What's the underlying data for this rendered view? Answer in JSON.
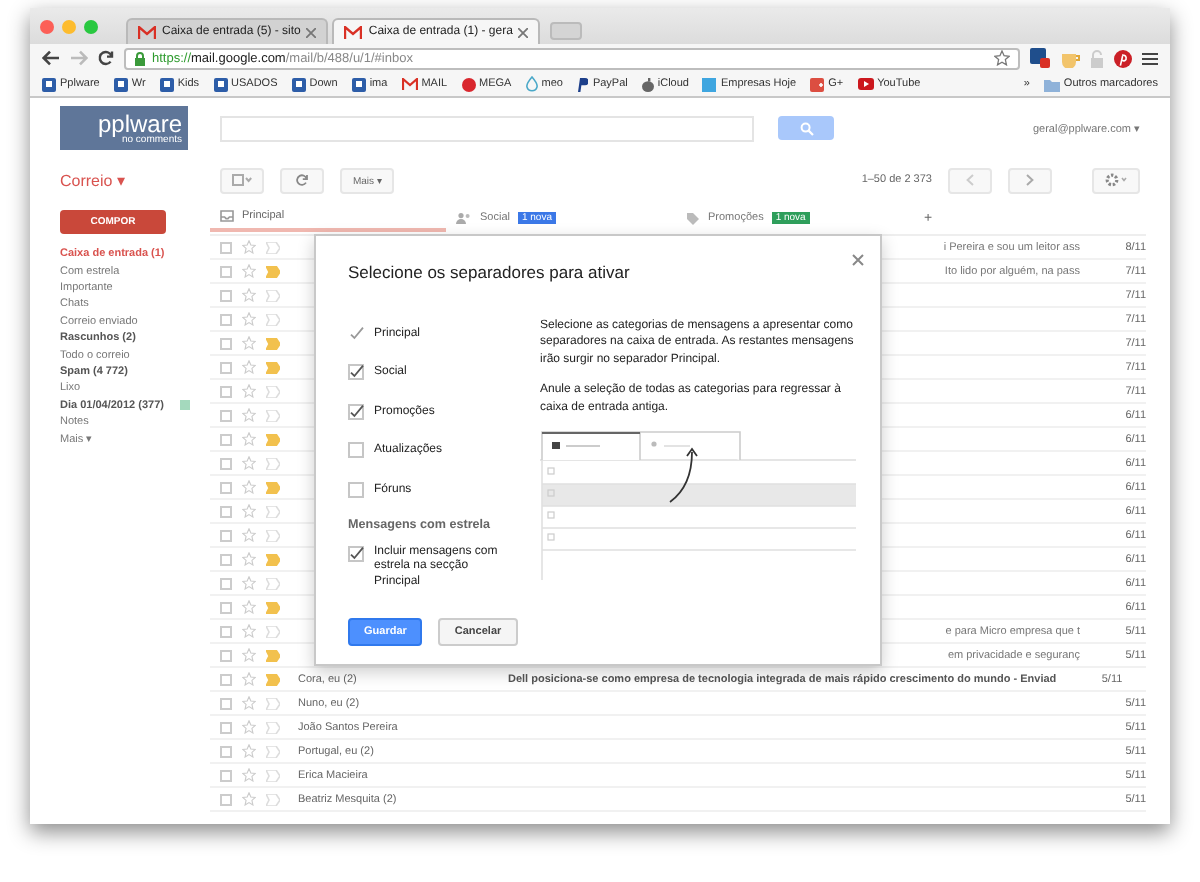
{
  "browser": {
    "tabs": [
      {
        "label": "Caixa de entrada (5) - sito",
        "selected": false
      },
      {
        "label": "Caixa de entrada (1) - gera",
        "selected": true
      }
    ],
    "url": {
      "scheme": "https://",
      "host": "mail.google.com",
      "path": "/mail/b/488/u/1/#inbox"
    },
    "bookmarks": [
      {
        "label": "Pplware",
        "kind": "square"
      },
      {
        "label": "Wr",
        "kind": "square"
      },
      {
        "label": "Kids",
        "kind": "square"
      },
      {
        "label": "USADOS",
        "kind": "square"
      },
      {
        "label": "Down",
        "kind": "square"
      },
      {
        "label": "ima",
        "kind": "square"
      },
      {
        "label": "MAIL",
        "kind": "mail"
      },
      {
        "label": "MEGA",
        "kind": "circle"
      },
      {
        "label": "meo",
        "kind": "drop"
      },
      {
        "label": "PayPal",
        "kind": "paypal"
      },
      {
        "label": "iCloud",
        "kind": "apple"
      },
      {
        "label": "Empresas Hoje",
        "kind": "site"
      },
      {
        "label": "G+",
        "kind": "gplus"
      },
      {
        "label": "YouTube",
        "kind": "video"
      }
    ],
    "more": "»",
    "other_bookmarks": "Outros marcadores"
  },
  "gmail": {
    "logo": {
      "name": "pplware",
      "tagline": "no comments"
    },
    "account": "geral@pplware.com ▾",
    "app_menu": "Correio ▾",
    "more_button": "Mais ▾",
    "pagination": "1–50 de 2 373",
    "compose": "COMPOR",
    "folders": [
      {
        "label": "Caixa de entrada (1)",
        "selected": true,
        "bold": true
      },
      {
        "label": "Com estrela",
        "selected": false,
        "bold": false
      },
      {
        "label": "Importante",
        "selected": false,
        "bold": false
      },
      {
        "label": "Chats",
        "selected": false,
        "bold": false
      },
      {
        "label": "Correio enviado",
        "selected": false,
        "bold": false
      },
      {
        "label": "Rascunhos (2)",
        "selected": false,
        "bold": true
      },
      {
        "label": "Todo o correio",
        "selected": false,
        "bold": false
      },
      {
        "label": "Spam (4 772)",
        "selected": false,
        "bold": true
      },
      {
        "label": "Lixo",
        "selected": false,
        "bold": false
      },
      {
        "label": "Dia 01/04/2012 (377)",
        "selected": false,
        "bold": true,
        "color": "#a4d9bd"
      },
      {
        "label": "Notes",
        "selected": false,
        "bold": false
      },
      {
        "label": "Mais ▾",
        "selected": false,
        "bold": false
      }
    ],
    "categories": [
      {
        "label": "Principal",
        "selected": true
      },
      {
        "label": "Social",
        "selected": false,
        "badge": "1 nova",
        "color": "#3b78e7"
      },
      {
        "label": "Promoções",
        "selected": false,
        "badge": "1 nova",
        "color": "#2e9e5b"
      }
    ],
    "add_tab": "+",
    "rows": [
      {
        "snippet": "i Pereira e sou um leitor ass",
        "date": "8/11",
        "important": false
      },
      {
        "snippet": "Ito lido por alguém, na pass",
        "date": "7/11",
        "important": true
      },
      {
        "date": "7/11",
        "important": false
      },
      {
        "date": "7/11",
        "important": false
      },
      {
        "date": "7/11",
        "important": true
      },
      {
        "date": "7/11",
        "important": true
      },
      {
        "date": "7/11",
        "important": false
      },
      {
        "date": "6/11",
        "important": false
      },
      {
        "date": "6/11",
        "important": true
      },
      {
        "date": "6/11",
        "important": false
      },
      {
        "date": "6/11",
        "important": true
      },
      {
        "date": "6/11",
        "important": false
      },
      {
        "date": "6/11",
        "important": false
      },
      {
        "date": "6/11",
        "important": true
      },
      {
        "date": "6/11",
        "important": false
      },
      {
        "date": "6/11",
        "important": true
      },
      {
        "snippet": "e para Micro empresa que t",
        "date": "5/11",
        "important": false
      },
      {
        "snippet": "em privacidade e seguranç",
        "date": "5/11",
        "important": true
      },
      {
        "sender": "Cora, eu (2)",
        "snippet": "Dell posiciona-se como empresa de tecnologia integrada de mais rápido crescimento do mundo - Enviad",
        "date": "5/11",
        "important": true
      },
      {
        "sender": "Nuno, eu (2)",
        "date": "5/11",
        "important": false
      },
      {
        "sender": "João Santos Pereira",
        "date": "5/11",
        "important": false
      },
      {
        "sender": "Portugal, eu (2)",
        "date": "5/11",
        "important": false
      },
      {
        "sender": "Erica Macieira",
        "date": "5/11",
        "important": false
      },
      {
        "sender": "Beatriz Mesquita (2)",
        "date": "5/11",
        "important": false
      }
    ]
  },
  "dialog": {
    "title": "Selecione os separadores para ativar",
    "options": [
      {
        "label": "Principal",
        "checked": true,
        "disabled": true
      },
      {
        "label": "Social",
        "checked": true,
        "disabled": false
      },
      {
        "label": "Promoções",
        "checked": true,
        "disabled": false
      },
      {
        "label": "Atualizações",
        "checked": false,
        "disabled": false
      },
      {
        "label": "Fóruns",
        "checked": false,
        "disabled": false
      }
    ],
    "starred_heading": "Mensagens com estrela",
    "starred_option": {
      "label": "Incluir mensagens com estrela na secção Principal",
      "checked": true
    },
    "description": "Selecione as categorias de mensagens a apresentar como separadores na caixa de entrada. As restantes mensagens irão surgir no separador Principal.",
    "note": "Anule a seleção de todas as categorias para regressar à caixa de entrada antiga.",
    "buttons": [
      {
        "label": "Guardar",
        "kind": "primary"
      },
      {
        "label": "Cancelar",
        "kind": "secondary"
      }
    ]
  }
}
